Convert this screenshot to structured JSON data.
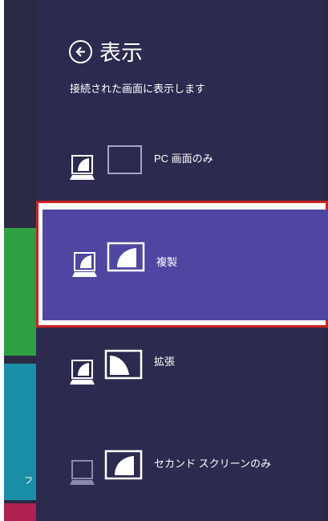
{
  "panel": {
    "title": "表示",
    "subtitle": "接続された画面に表示します"
  },
  "options": [
    {
      "label": "PC 画面のみ",
      "selected": false
    },
    {
      "label": "複製",
      "selected": true
    },
    {
      "label": "拡張",
      "selected": false
    },
    {
      "label": "セカンド スクリーンのみ",
      "selected": false
    }
  ],
  "start_tiles": {
    "partial_text": "フ"
  },
  "colors": {
    "panel_bg": "#2d2a4f",
    "selected_bg": "#4e46a0",
    "highlight_border": "#cc2222",
    "tile_green": "#2ea043",
    "tile_teal": "#1a8ea6",
    "tile_red": "#b02254"
  }
}
